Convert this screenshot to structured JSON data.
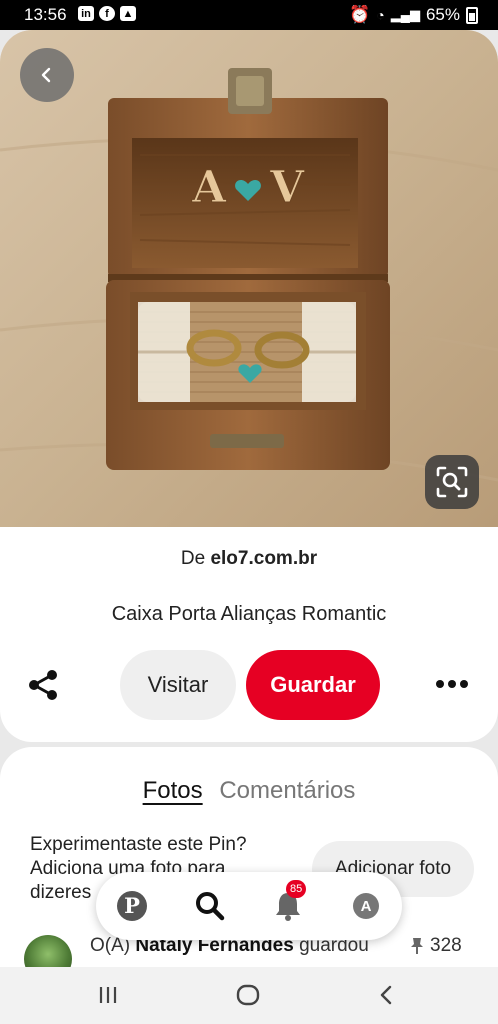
{
  "status_bar": {
    "time": "13:56",
    "notif_icons": [
      "linkedin-icon",
      "facebook-icon",
      "image-icon"
    ],
    "battery": "65%",
    "right_icons": [
      "alarm-icon",
      "wifi-icon",
      "signal-icon",
      "battery-icon"
    ]
  },
  "pin": {
    "source_prefix": "De",
    "source_domain": "elo7.com.br",
    "title": "Caixa Porta Alianças Romantic",
    "photo_letters": "A V"
  },
  "actions": {
    "visit_label": "Visitar",
    "save_label": "Guardar"
  },
  "tabs": {
    "photos": "Fotos",
    "comments": "Comentários"
  },
  "try_it": {
    "line1": "Experimentaste este Pin?",
    "line2": "Adiciona uma foto para",
    "line3": "dizeres",
    "button": "Adicionar foto"
  },
  "activity": {
    "prefix": "O(A)",
    "user": "Nataly Fernandes",
    "action": "guardou",
    "pin_count": "328"
  },
  "nav": {
    "notifications_badge": "85",
    "profile_initial": "A"
  },
  "colors": {
    "brand_red": "#e60023",
    "teal_heart": "#3aa8a3"
  }
}
